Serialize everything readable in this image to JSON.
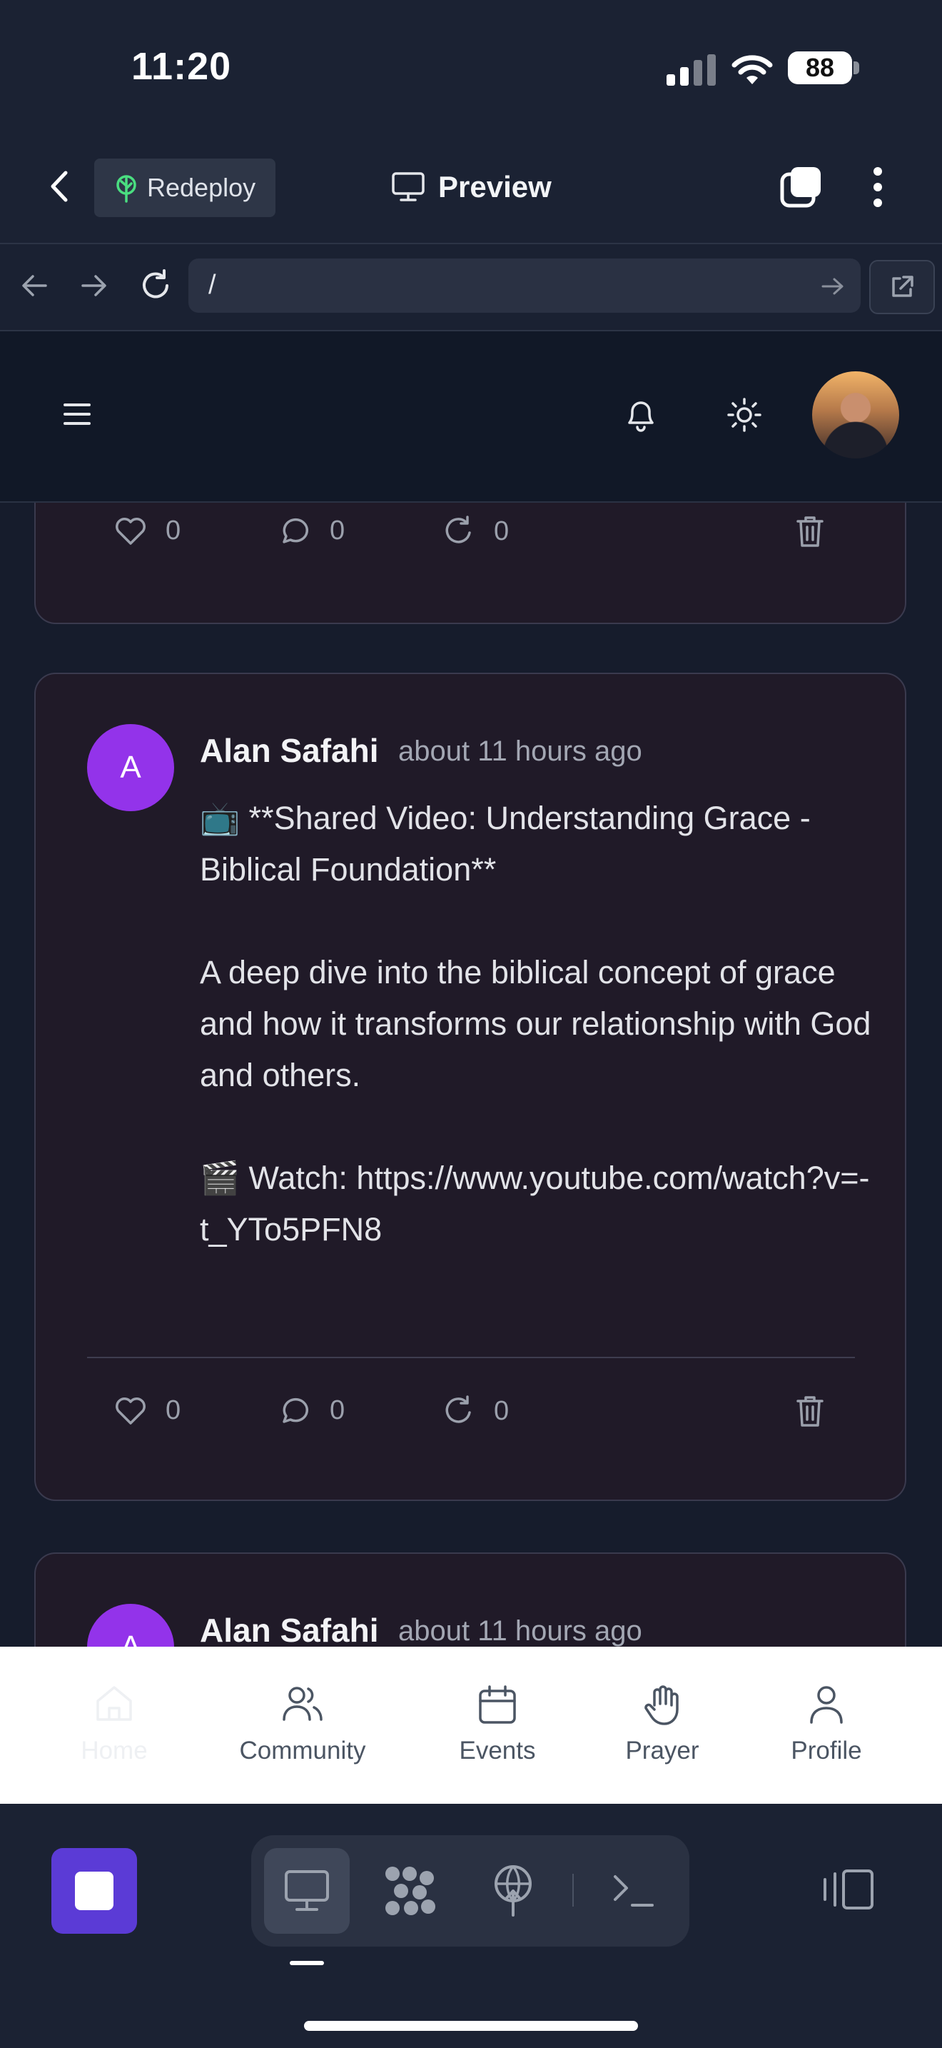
{
  "status_bar": {
    "time": "11:20",
    "battery": "88"
  },
  "app_header": {
    "redeploy_label": "Redeploy",
    "preview_label": "Preview"
  },
  "url_bar": {
    "url": "/"
  },
  "feed": {
    "card_top_stats": {
      "likes": "0",
      "comments": "0",
      "reposts": "0"
    },
    "post": {
      "avatar_initial": "A",
      "author": "Alan Safahi",
      "time_ago": "about 11 hours ago",
      "line1_emoji": "📺",
      "line1": "**Shared Video: Understanding Grace - Biblical Foundation**",
      "line2": "A deep dive into the biblical concept of grace and how it transforms our relationship with God and others.",
      "line3_emoji": "🎬",
      "line3": "Watch: https://www.youtube.com/watch?v=-t_YTo5PFN8",
      "likes": "0",
      "comments": "0",
      "reposts": "0"
    },
    "next_post": {
      "avatar_initial": "A",
      "author": "Alan Safahi",
      "time_ago": "about 11 hours ago"
    }
  },
  "bottom_nav": {
    "items": [
      {
        "label": "Home",
        "icon": "home-icon",
        "active": true
      },
      {
        "label": "Community",
        "icon": "users-icon"
      },
      {
        "label": "Events",
        "icon": "calendar-icon"
      },
      {
        "label": "Prayer",
        "icon": "hand-icon"
      },
      {
        "label": "Profile",
        "icon": "user-icon"
      }
    ]
  },
  "colors": {
    "card_bg": "#201a28",
    "avatar_purple": "#9333ea",
    "stop_button": "#5b3bd6",
    "app_chrome": "#1b2233"
  }
}
